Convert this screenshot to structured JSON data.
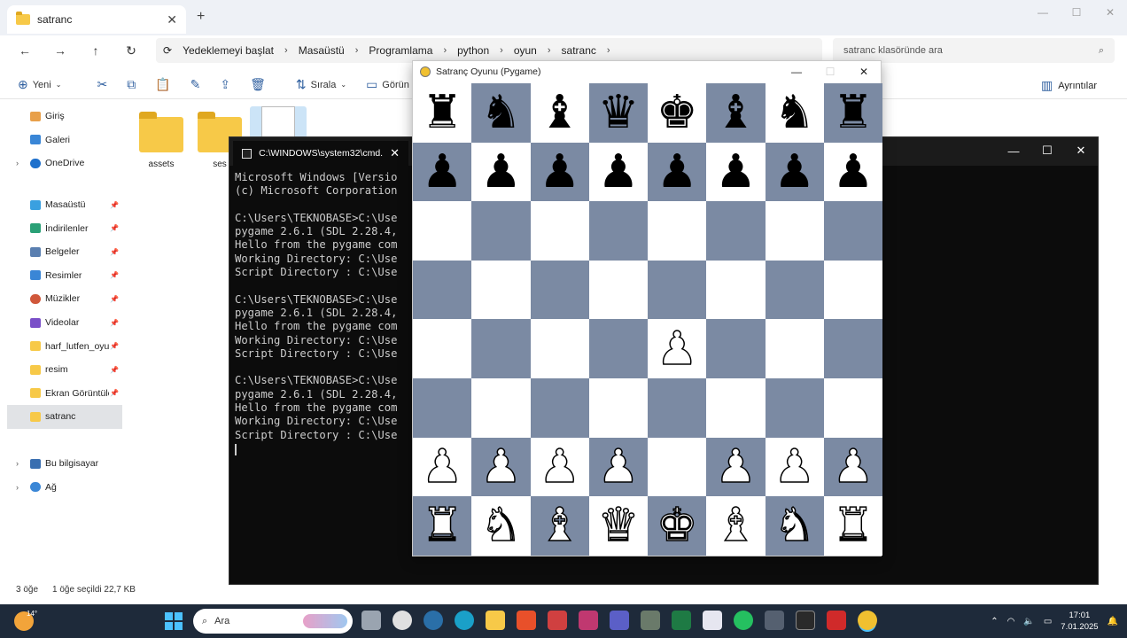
{
  "explorer": {
    "tab_title": "satranc",
    "breadcrumb": [
      "Yedeklemeyi başlat",
      "Masaüstü",
      "Programlama",
      "python",
      "oyun",
      "satranc"
    ],
    "search_placeholder": "satranc klasöründe ara",
    "toolbar": {
      "new_label": "Yeni",
      "sort_label": "Sırala",
      "view_label": "Görün",
      "details_label": "Ayrıntılar"
    },
    "sidebar": {
      "top": [
        "Giriş",
        "Galeri",
        "OneDrive"
      ],
      "quick": [
        "Masaüstü",
        "İndirilenler",
        "Belgeler",
        "Resimler",
        "Müzikler",
        "Videolar",
        "harf_lutfen_oyun",
        "resim",
        "Ekran Görüntüleri",
        "satranc"
      ],
      "bottom": [
        "Bu bilgisayar",
        "Ağ"
      ]
    },
    "files": [
      "assets",
      "ses",
      ""
    ],
    "status": {
      "count": "3 öğe",
      "selection": "1 öğe seçildi  22,7 KB"
    }
  },
  "cmd": {
    "tab_title": "C:\\WINDOWS\\system32\\cmd.",
    "lines": [
      "Microsoft Windows [Versio",
      "(c) Microsoft Corporation",
      "",
      "C:\\Users\\TEKNOBASE>C:\\Use",
      "pygame 2.6.1 (SDL 2.28.4,",
      "Hello from the pygame com",
      "Working Directory: C:\\Use",
      "Script Directory : C:\\Use",
      "",
      "C:\\Users\\TEKNOBASE>C:\\Use",
      "pygame 2.6.1 (SDL 2.28.4,",
      "Hello from the pygame com",
      "Working Directory: C:\\Use",
      "Script Directory : C:\\Use",
      "",
      "C:\\Users\\TEKNOBASE>C:\\Use",
      "pygame 2.6.1 (SDL 2.28.4,",
      "Hello from the pygame com",
      "Working Directory: C:\\Use",
      "Script Directory : C:\\Use"
    ]
  },
  "chess": {
    "title": "Satranç Oyunu (Pygame)",
    "light_color": "#ffffff",
    "dark_color": "#7b8aa3",
    "board": [
      [
        "br",
        "bn",
        "bb",
        "bq",
        "bk",
        "bb",
        "bn",
        "br"
      ],
      [
        "bp",
        "bp",
        "bp",
        "bp",
        "bp",
        "bp",
        "bp",
        "bp"
      ],
      [
        "",
        "",
        "",
        "",
        "",
        "",
        "",
        ""
      ],
      [
        "",
        "",
        "",
        "",
        "",
        "",
        "",
        ""
      ],
      [
        "",
        "",
        "",
        "",
        "wp",
        "",
        "",
        ""
      ],
      [
        "",
        "",
        "",
        "",
        "",
        "",
        "",
        ""
      ],
      [
        "wp",
        "wp",
        "wp",
        "wp",
        "",
        "wp",
        "wp",
        "wp"
      ],
      [
        "wr",
        "wn",
        "wb",
        "wq",
        "wk",
        "wb",
        "wn",
        "wr"
      ]
    ]
  },
  "taskbar": {
    "weather_temp": "14°",
    "search_placeholder": "Ara",
    "time": "17:01",
    "date": "7.01.2025"
  }
}
